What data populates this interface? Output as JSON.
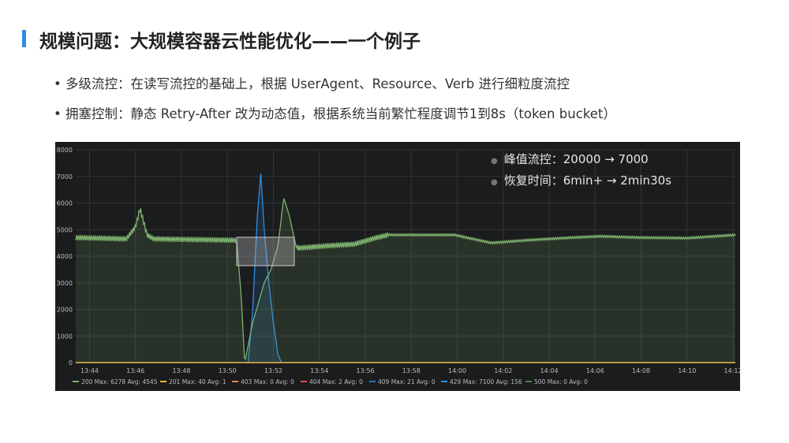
{
  "title": "规模问题：大规模容器云性能优化——一个例子",
  "bullets": [
    "• 多级流控：在读写流控的基础上，根据 UserAgent、Resource、Verb 进行细粒度流控",
    "• 拥塞控制：静态 Retry-After 改为动态值，根据系统当前繁忙程度调节1到8s（token bucket）"
  ],
  "annotations": [
    "峰值流控：20000 → 7000",
    "恢复时间：6min+ → 2min30s"
  ],
  "chart_data": {
    "type": "line",
    "title": "",
    "xlabel": "",
    "ylabel": "",
    "ylim": [
      0,
      8000
    ],
    "yticks": [
      "0",
      "1000",
      "2000",
      "3000",
      "4000",
      "5000",
      "6000",
      "7000",
      "8000"
    ],
    "xticks": [
      "13:44",
      "13:46",
      "13:48",
      "13:50",
      "13:52",
      "13:54",
      "13:56",
      "13:58",
      "14:00",
      "14:02",
      "14:04",
      "14:06",
      "14:08",
      "14:10",
      "14:12"
    ],
    "x_unit": "minutes after 13:44",
    "xlim": [
      -0.6,
      28.1
    ],
    "grid": true,
    "legend_position": "bottom",
    "series": [
      {
        "name": "200",
        "legend": "200 Max: 6278 Avg: 4545",
        "color": "#7eb26d",
        "fill": true,
        "points": [
          [
            -0.6,
            4700
          ],
          [
            1.6,
            4650
          ],
          [
            2.0,
            5100
          ],
          [
            2.2,
            5800
          ],
          [
            2.5,
            4800
          ],
          [
            2.8,
            4650
          ],
          [
            6.4,
            4600
          ],
          [
            6.6,
            2500
          ],
          [
            6.75,
            0
          ],
          [
            7.1,
            1500
          ],
          [
            7.6,
            3000
          ],
          [
            7.9,
            3500
          ],
          [
            8.2,
            4400
          ],
          [
            8.45,
            6200
          ],
          [
            8.7,
            5500
          ],
          [
            9.0,
            4300
          ],
          [
            10.5,
            4400
          ],
          [
            11.5,
            4450
          ],
          [
            12.5,
            4700
          ],
          [
            13.0,
            4800
          ],
          [
            15.9,
            4800
          ],
          [
            16.4,
            4700
          ],
          [
            17.5,
            4500
          ],
          [
            19.0,
            4600
          ],
          [
            21.0,
            4700
          ],
          [
            22.2,
            4750
          ],
          [
            24.0,
            4700
          ],
          [
            26.0,
            4680
          ],
          [
            28.1,
            4800
          ]
        ]
      },
      {
        "name": "201",
        "legend": "201 Max: 40 Avg: 1",
        "color": "#eab839",
        "points": [
          [
            -0.6,
            0
          ],
          [
            28.1,
            0
          ]
        ]
      },
      {
        "name": "403",
        "legend": "403 Max: 0 Avg: 0",
        "color": "#ef843c",
        "points": [
          [
            -0.6,
            0
          ],
          [
            28.1,
            0
          ]
        ]
      },
      {
        "name": "404",
        "legend": "404 Max: 2 Avg: 0",
        "color": "#e24d42",
        "points": [
          [
            -0.6,
            0
          ],
          [
            28.1,
            0
          ]
        ]
      },
      {
        "name": "409",
        "legend": "409 Max: 21 Avg: 0",
        "color": "#1f78c1",
        "points": [
          [
            -0.6,
            0
          ],
          [
            28.1,
            0
          ]
        ]
      },
      {
        "name": "429",
        "legend": "429 Max: 7100 Avg: 156",
        "color": "#2f8de4",
        "fill": true,
        "points": [
          [
            -0.6,
            0
          ],
          [
            6.9,
            0
          ],
          [
            7.1,
            2000
          ],
          [
            7.3,
            5500
          ],
          [
            7.45,
            7100
          ],
          [
            7.6,
            5000
          ],
          [
            7.8,
            3000
          ],
          [
            8.0,
            1500
          ],
          [
            8.2,
            300
          ],
          [
            8.35,
            0
          ],
          [
            28.1,
            0
          ]
        ]
      },
      {
        "name": "500",
        "legend": "500 Max: 0 Avg: 0",
        "color": "#508642",
        "points": [
          [
            -0.6,
            0
          ],
          [
            28.1,
            0
          ]
        ]
      }
    ]
  }
}
